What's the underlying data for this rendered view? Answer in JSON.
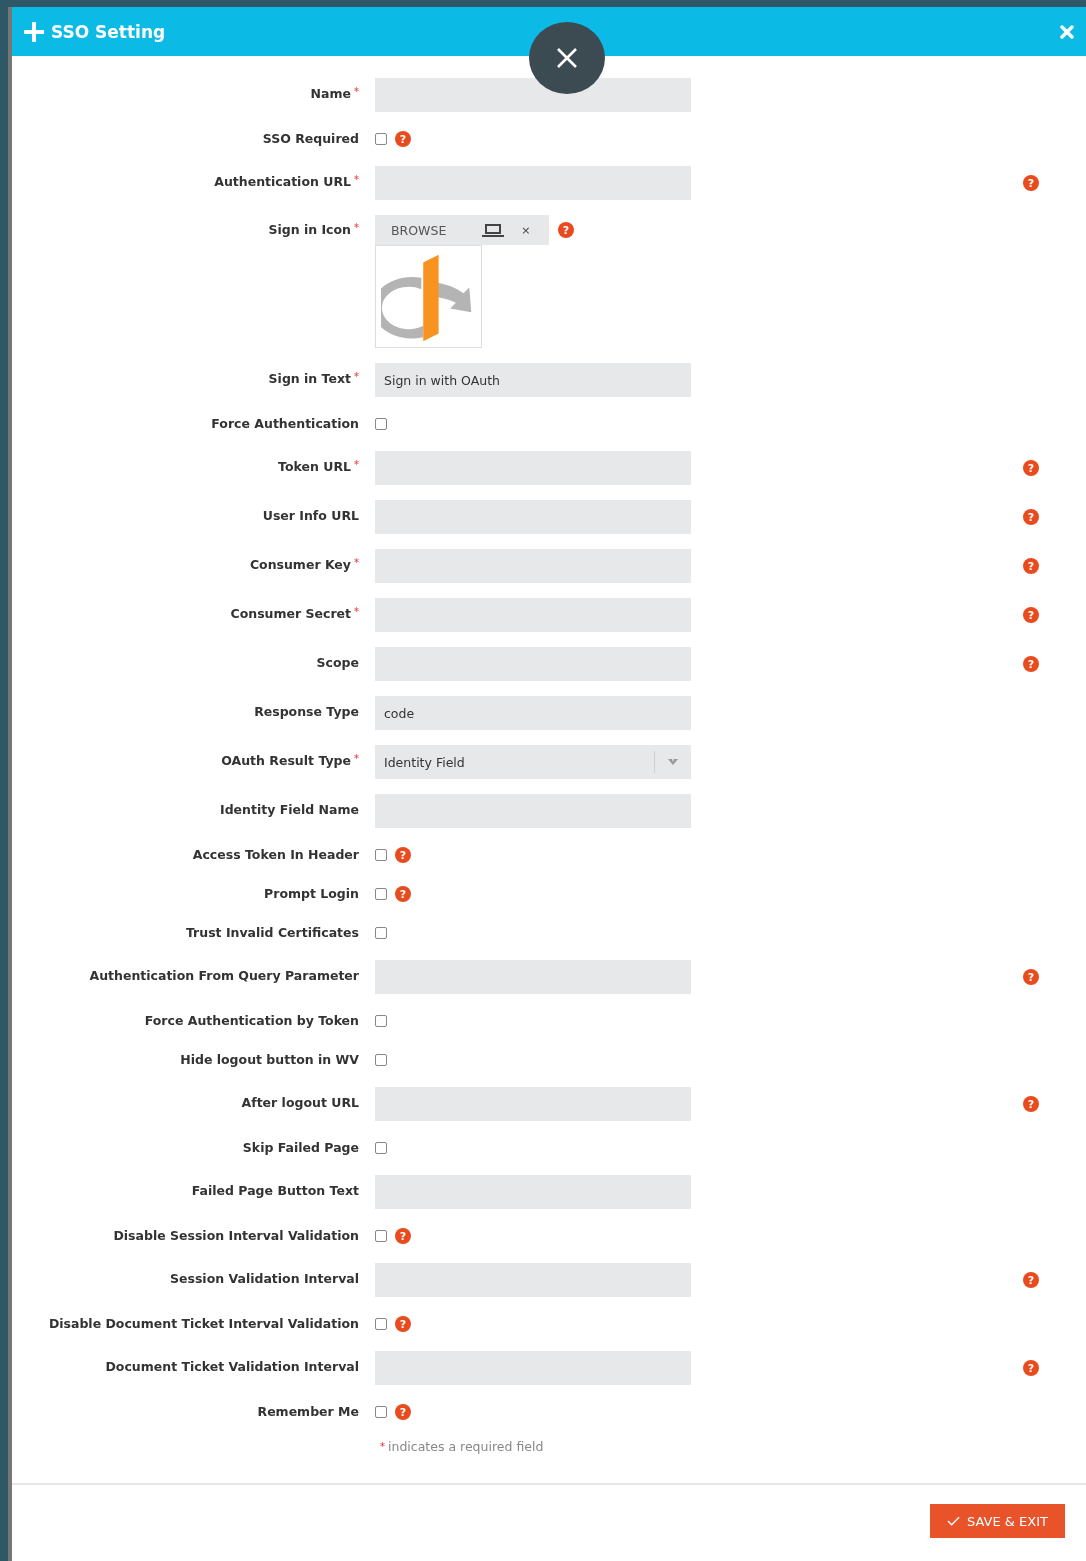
{
  "dialog": {
    "title": "SSO Setting"
  },
  "fields": [
    {
      "kind": "text",
      "label": "Name",
      "required_mark": "*"
    },
    {
      "kind": "checkbox",
      "label": "SSO Required",
      "checked": false,
      "help": "?"
    },
    {
      "kind": "text",
      "label": "Authentication URL",
      "required_mark": "*",
      "help": "?"
    },
    {
      "kind": "file",
      "label": "Sign in Icon",
      "required_mark": "*",
      "button": "BROWSE",
      "remove": "×",
      "help": "?"
    },
    {
      "kind": "text",
      "label": "Sign in Text",
      "required_mark": "*",
      "value": "Sign in with OAuth"
    },
    {
      "kind": "checkbox",
      "label": "Force Authentication",
      "checked": false
    },
    {
      "kind": "text",
      "label": "Token URL",
      "required_mark": "*",
      "help": "?"
    },
    {
      "kind": "text",
      "label": "User Info URL",
      "help": "?"
    },
    {
      "kind": "text",
      "label": "Consumer Key",
      "required_mark": "*",
      "help": "?"
    },
    {
      "kind": "text",
      "label": "Consumer Secret",
      "required_mark": "*",
      "help": "?"
    },
    {
      "kind": "text",
      "label": "Scope",
      "help": "?"
    },
    {
      "kind": "text",
      "label": "Response Type",
      "value": "code"
    },
    {
      "kind": "select",
      "label": "OAuth Result Type",
      "required_mark": "*",
      "value": "Identity Field"
    },
    {
      "kind": "text",
      "label": "Identity Field Name"
    },
    {
      "kind": "checkbox",
      "label": "Access Token In Header",
      "checked": false,
      "help": "?"
    },
    {
      "kind": "checkbox",
      "label": "Prompt Login",
      "checked": false,
      "help": "?"
    },
    {
      "kind": "checkbox",
      "label": "Trust Invalid Certificates",
      "checked": false
    },
    {
      "kind": "text",
      "label": "Authentication From Query Parameter",
      "help": "?"
    },
    {
      "kind": "checkbox",
      "label": "Force Authentication by Token",
      "checked": false
    },
    {
      "kind": "checkbox",
      "label": "Hide logout button in WV",
      "checked": false
    },
    {
      "kind": "text",
      "label": "After logout URL",
      "help": "?"
    },
    {
      "kind": "checkbox",
      "label": "Skip Failed Page",
      "checked": false
    },
    {
      "kind": "text",
      "label": "Failed Page Button Text"
    },
    {
      "kind": "checkbox",
      "label": "Disable Session Interval Validation",
      "checked": false,
      "help": "?"
    },
    {
      "kind": "text",
      "label": "Session Validation Interval",
      "help": "?"
    },
    {
      "kind": "checkbox",
      "label": "Disable Document Ticket Interval Validation",
      "checked": false,
      "help": "?"
    },
    {
      "kind": "text",
      "label": "Document Ticket Validation Interval",
      "help": "?"
    },
    {
      "kind": "checkbox",
      "label": "Remember Me",
      "checked": false,
      "help": "?"
    }
  ],
  "footnote": {
    "required_mark": "*",
    "text": "indicates a required field"
  },
  "buttons": [
    {
      "label": "SAVE & EXIT"
    }
  ]
}
